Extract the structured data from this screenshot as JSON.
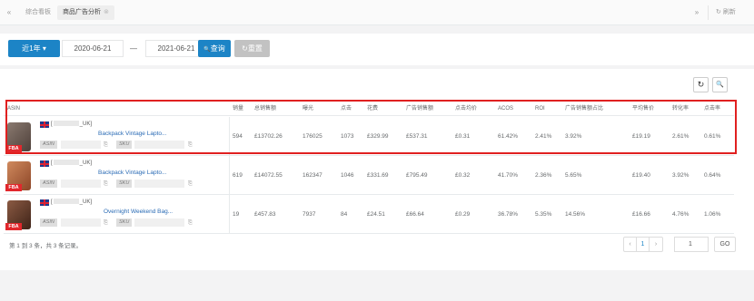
{
  "tabs": {
    "prev_icon": "«",
    "items": [
      {
        "label": "综合看板"
      },
      {
        "label": "商品广告分析",
        "close_icon": "⊗"
      }
    ],
    "next_icon": "»",
    "refresh_icon": "↻",
    "refresh_label": "刷新"
  },
  "filter": {
    "range_label": "近1年",
    "range_caret": "▾",
    "start_date": "2020-06-21",
    "separator": "—",
    "end_date": "2021-06-21",
    "search_icon": "🔍",
    "search_label": "查询",
    "reset_icon": "↻",
    "reset_label": "重置"
  },
  "toolbar": {
    "refresh_icon": "↻",
    "search_icon": "🔍"
  },
  "table": {
    "columns": [
      "ASIN",
      "销量",
      "总销售额",
      "曝光",
      "点击",
      "花费",
      "广告销售额",
      "点击均价",
      "ACOS",
      "ROI",
      "广告销售额占比",
      "平均售价",
      "转化率",
      "点击率"
    ],
    "rows": [
      {
        "store": "[",
        "store_suffix": "_UK]",
        "title": "Backpack Vintage Lapto...",
        "badge": "FBA",
        "asin_tag": "ASIN",
        "sku_tag": "SKU",
        "copy_icon": "⎘",
        "cells": [
          "594",
          "£13702.26",
          "176025",
          "1073",
          "£329.99",
          "£537.31",
          "£0.31",
          "61.42%",
          "2.41%",
          "3.92%",
          "£19.19",
          "2.61%",
          "0.61%"
        ]
      },
      {
        "store": "[",
        "store_suffix": "_UK]",
        "title": "Backpack Vintage Lapto...",
        "badge": "FBA",
        "asin_tag": "ASIN",
        "sku_tag": "SKU",
        "copy_icon": "⎘",
        "cells": [
          "619",
          "£14072.55",
          "162347",
          "1046",
          "£331.69",
          "£795.49",
          "£0.32",
          "41.70%",
          "2.36%",
          "5.65%",
          "£19.40",
          "3.92%",
          "0.64%"
        ]
      },
      {
        "store": "[",
        "store_suffix": "_UK]",
        "title": "Overnight Weekend Bag...",
        "badge": "FBA",
        "asin_tag": "ASIN",
        "sku_tag": "SKU",
        "copy_icon": "⎘",
        "cells": [
          "19",
          "£457.83",
          "7937",
          "84",
          "£24.51",
          "£66.64",
          "£0.29",
          "36.78%",
          "5.35%",
          "14.56%",
          "£16.66",
          "4.76%",
          "1.06%"
        ]
      }
    ],
    "colors": {
      "row_thumb_1": "#6b5a52",
      "row_thumb_2": "#b7603b",
      "row_thumb_3": "#5e3a2a",
      "highlight": "#e02020"
    }
  },
  "footer": {
    "summary": "第 1 到 3 条，共 3 条记录。",
    "prev": "‹",
    "current_page": "1",
    "next": "›",
    "page_input": "1",
    "go_label": "GO"
  }
}
